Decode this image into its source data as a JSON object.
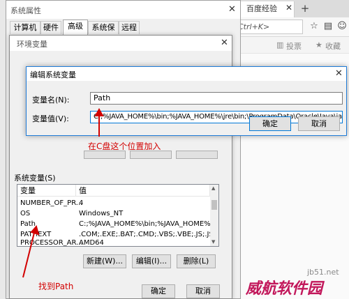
{
  "browser": {
    "tabs": [
      "百度经验"
    ],
    "new_tab": "+",
    "address_hint": "Ctrl+K>",
    "actions": [
      "投票",
      "收藏"
    ]
  },
  "sysprops": {
    "title": "系统属性",
    "tabs": [
      "计算机名",
      "硬件",
      "高级",
      "系统保护",
      "远程"
    ],
    "active_tab": "高级"
  },
  "envvars": {
    "title": "环境变量",
    "system_section_label": "系统变量(S)",
    "columns": [
      "变量",
      "值"
    ],
    "rows": [
      {
        "name": "NUMBER_OF_PR...",
        "value": "4"
      },
      {
        "name": "OS",
        "value": "Windows_NT"
      },
      {
        "name": "Path",
        "value": "C:;%JAVA_HOME%\\bin;%JAVA_HOME%\\jre\\bi..."
      },
      {
        "name": "PATHEXT",
        "value": ".COM;.EXE;.BAT;.CMD;.VBS;.VBE;.JS;.JSE;..."
      },
      {
        "name": "PROCESSOR_AR...",
        "value": "AMD64"
      }
    ],
    "buttons": {
      "new": "新建(W)...",
      "edit": "编辑(I)...",
      "delete": "删除(L)"
    },
    "ok": "确定",
    "cancel": "取消"
  },
  "edit_dialog": {
    "title": "编辑系统变量",
    "name_label": "变量名(N):",
    "name_value": "Path",
    "value_label": "变量值(V):",
    "value_value": "C:;%JAVA_HOME%\\bin;%JAVA_HOME%\\jre\\bin;\\ProgramData\\Oracle\\Java\\javapath;%S",
    "ok": "确定",
    "cancel": "取消"
  },
  "annotations": {
    "edit_hint": "在C盘这个位置加入",
    "find_hint": "找到Path"
  },
  "watermark": {
    "site": "jb51.net",
    "brand": "威航软件园"
  },
  "colors": {
    "annotation": "#d20000",
    "dialog_border": "#1e7bd8",
    "watermark": "#c2185b"
  }
}
